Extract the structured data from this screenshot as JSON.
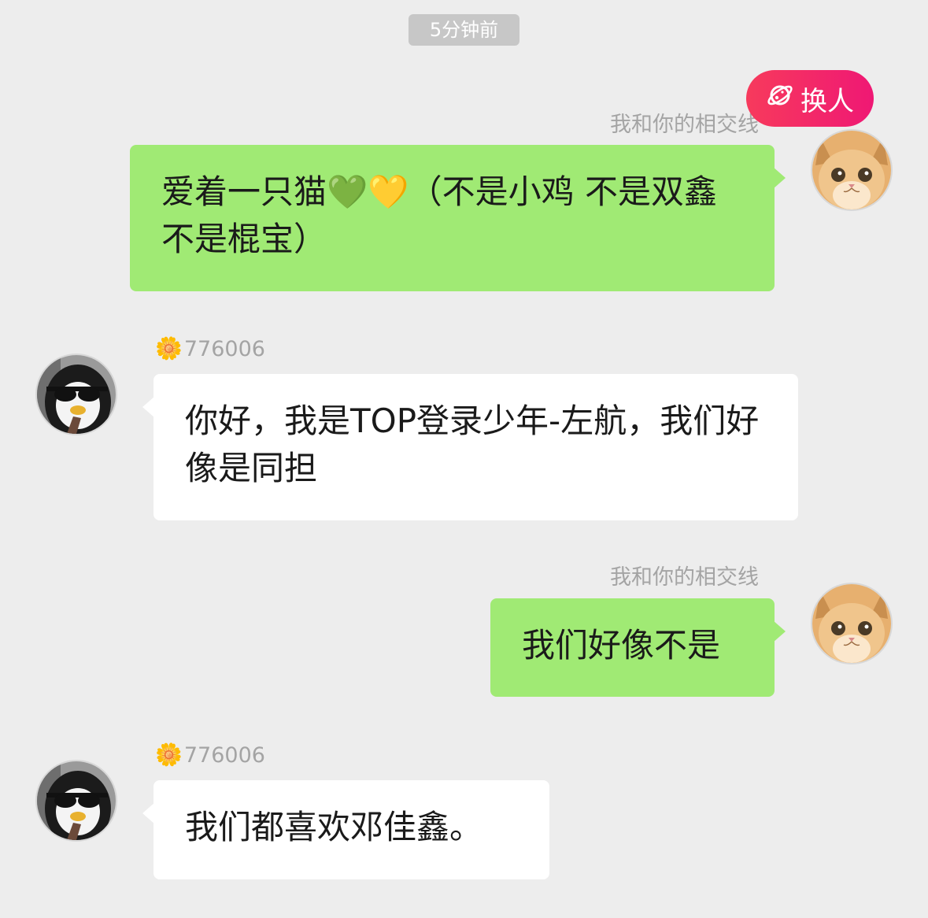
{
  "timestamp": "5分钟前",
  "switch_button": {
    "label": "换人",
    "icon": "planet-icon",
    "gradient": [
      "#f73a5c",
      "#ef1874"
    ]
  },
  "colors": {
    "background": "#ededed",
    "my_bubble": "#a0ea74",
    "their_bubble": "#ffffff"
  },
  "messages": [
    {
      "sender": "me",
      "name": "我和你的相交线",
      "avatar": "cat-avatar",
      "text": "爱着一只猫💚💛（不是小鸡 不是双鑫 不是棍宝）"
    },
    {
      "sender": "them",
      "name": "776006",
      "name_prefix": "🌼",
      "avatar": "penguin-sunglasses-avatar",
      "text": "你好，我是TOP登录少年-左航，我们好像是同担"
    },
    {
      "sender": "me",
      "name": "我和你的相交线",
      "avatar": "cat-avatar",
      "text": "我们好像不是"
    },
    {
      "sender": "them",
      "name": "776006",
      "name_prefix": "🌼",
      "avatar": "penguin-sunglasses-avatar",
      "text": "我们都喜欢邓佳鑫。"
    }
  ]
}
